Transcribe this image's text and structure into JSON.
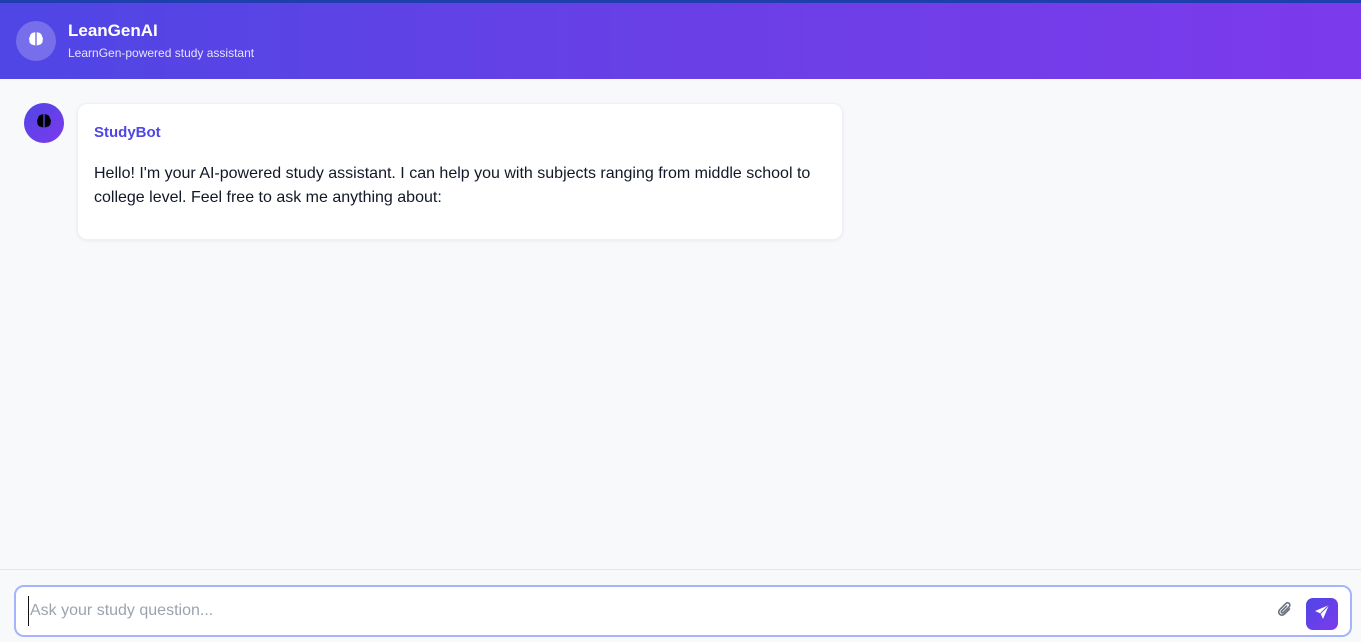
{
  "header": {
    "title": "LeanGenAI",
    "subtitle": "LearnGen-powered study assistant",
    "logo_icon": "brain-icon"
  },
  "messages": [
    {
      "sender": "StudyBot",
      "avatar_icon": "brain-icon",
      "text": "Hello! I'm your AI-powered study assistant. I can help you with subjects ranging from middle school to college level. Feel free to ask me anything about:"
    }
  ],
  "composer": {
    "placeholder": "Ask your study question...",
    "value": "",
    "attach_icon": "paperclip-icon",
    "send_icon": "send-icon"
  },
  "colors": {
    "accent": "#4f46e5",
    "accent_end": "#7c3aed",
    "background": "#f8f9fb"
  }
}
